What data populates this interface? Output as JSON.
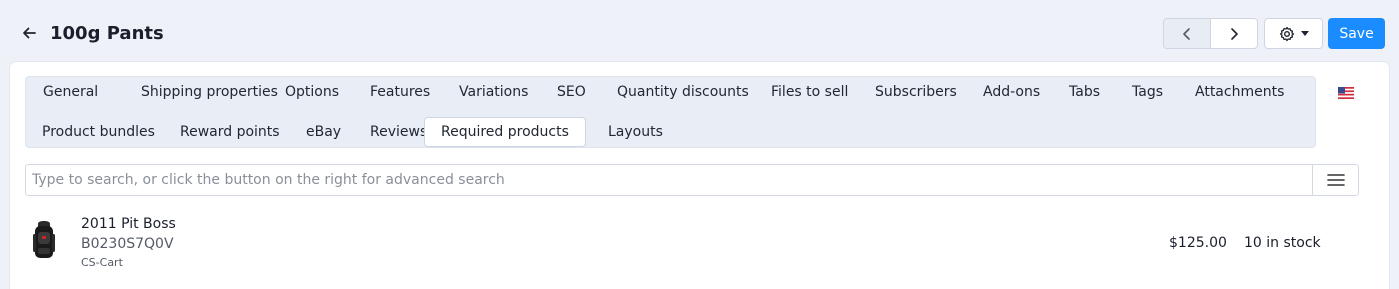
{
  "header": {
    "title": "100g Pants",
    "save_label": "Save"
  },
  "tabs": [
    {
      "label": "General",
      "active": false
    },
    {
      "label": "Shipping properties",
      "active": false
    },
    {
      "label": "Options",
      "active": false
    },
    {
      "label": "Features",
      "active": false
    },
    {
      "label": "Variations",
      "active": false
    },
    {
      "label": "SEO",
      "active": false
    },
    {
      "label": "Quantity discounts",
      "active": false
    },
    {
      "label": "Files to sell",
      "active": false
    },
    {
      "label": "Subscribers",
      "active": false
    },
    {
      "label": "Add-ons",
      "active": false
    },
    {
      "label": "Tabs",
      "active": false
    },
    {
      "label": "Tags",
      "active": false
    },
    {
      "label": "Attachments",
      "active": false
    },
    {
      "label": "Product bundles",
      "active": false
    },
    {
      "label": "Reward points",
      "active": false
    },
    {
      "label": "eBay",
      "active": false
    },
    {
      "label": "Reviews",
      "active": false
    },
    {
      "label": "Required products",
      "active": true
    },
    {
      "label": "Layouts",
      "active": false
    }
  ],
  "language_flag": "us-flag-icon",
  "search": {
    "placeholder": "Type to search, or click the button on the right for advanced search",
    "value": ""
  },
  "products": [
    {
      "name": "2011 Pit Boss",
      "sku": "B0230S7Q0V",
      "vendor": "CS-Cart",
      "price": "$125.00",
      "stock": "10 in stock",
      "thumbnail": "backpack-image"
    }
  ],
  "colors": {
    "accent": "#1a8cff",
    "page_bg": "#eef1f8",
    "tabs_bg": "#e9edf5"
  }
}
